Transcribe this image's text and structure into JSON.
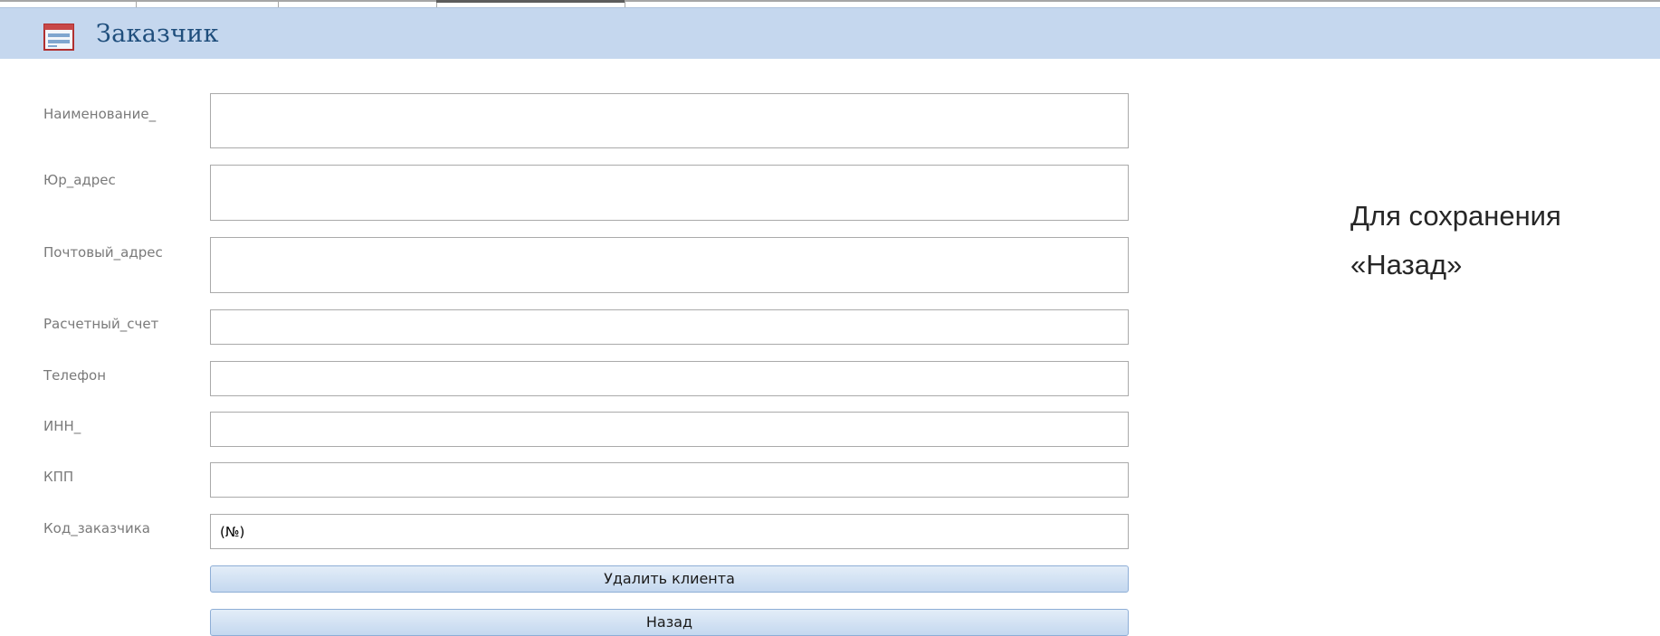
{
  "form": {
    "title": "Заказчик",
    "icon": "form-icon"
  },
  "fields": [
    {
      "label": "Наименование_",
      "value": ""
    },
    {
      "label": "Юр_адрес",
      "value": ""
    },
    {
      "label": "Почтовый_адрес",
      "value": ""
    },
    {
      "label": "Расчетный_счет",
      "value": ""
    },
    {
      "label": "Телефон",
      "value": ""
    },
    {
      "label": "ИНН_",
      "value": ""
    },
    {
      "label": "КПП",
      "value": ""
    },
    {
      "label": "Код_заказчика",
      "value": "(№)"
    }
  ],
  "buttons": {
    "delete_label": "Удалить клиента",
    "back_label": "Назад"
  },
  "note": {
    "line1": "Для сохранения",
    "line2": "«Назад»"
  },
  "colors": {
    "header_bg": "#c5d7ee",
    "title_color": "#1f4e7c",
    "button_bg": "#d4e3f5"
  }
}
